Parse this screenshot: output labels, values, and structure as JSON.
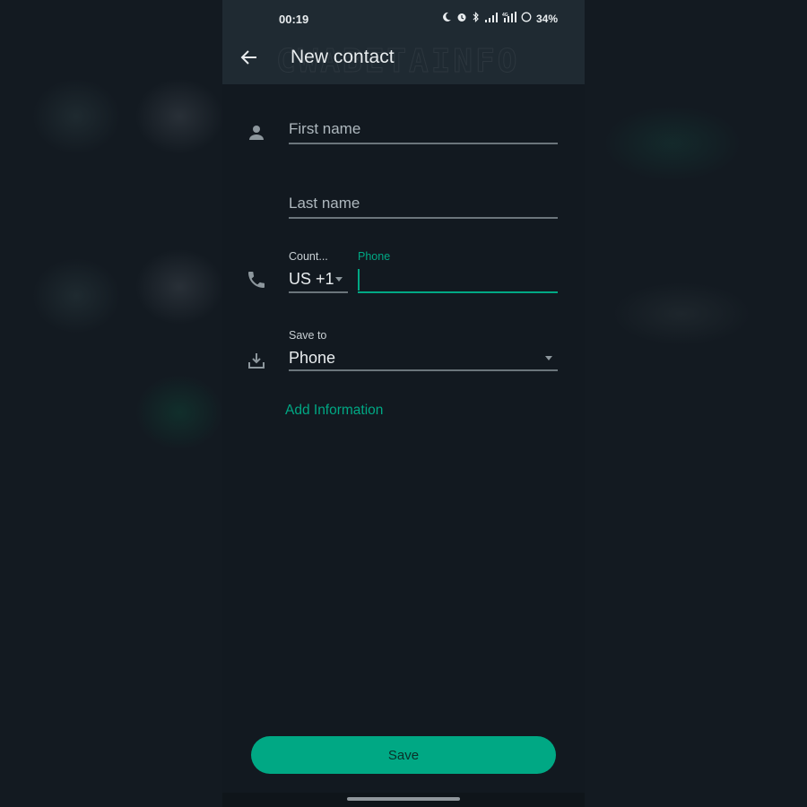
{
  "status_bar": {
    "time": "00:19",
    "icons": [
      "moon-icon",
      "alarm-icon",
      "bluetooth-icon",
      "wifi-signal-icon",
      "cellular-4g-icon",
      "battery-icon"
    ],
    "battery": "34%",
    "network_badge": "4G"
  },
  "app_bar": {
    "title": "New contact",
    "back_icon": "arrow-left-icon",
    "watermark": "CWABETAINFO"
  },
  "form": {
    "first_name": {
      "placeholder": "First name",
      "value": ""
    },
    "last_name": {
      "placeholder": "Last name",
      "value": ""
    },
    "country": {
      "label": "Count...",
      "value": "US +1"
    },
    "phone": {
      "label": "Phone",
      "value": ""
    },
    "save_to": {
      "label": "Save to",
      "value": "Phone"
    },
    "add_information": "Add Information"
  },
  "footer": {
    "save_label": "Save"
  },
  "colors": {
    "accent": "#00a884",
    "appbar_bg": "#1f2a32",
    "page_bg": "#121920"
  }
}
